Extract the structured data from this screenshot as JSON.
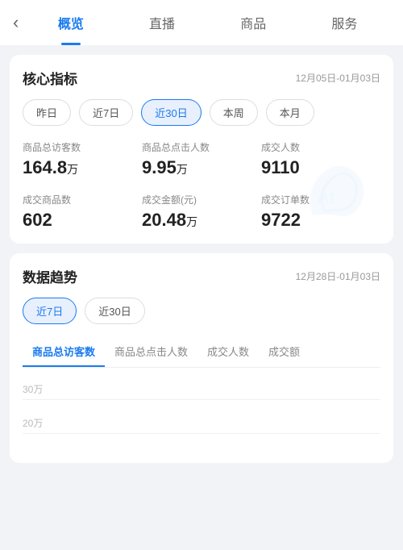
{
  "nav": {
    "back_icon": "‹",
    "tabs": [
      {
        "label": "概览",
        "active": true
      },
      {
        "label": "直播",
        "active": false
      },
      {
        "label": "商品",
        "active": false
      },
      {
        "label": "服务",
        "active": false
      }
    ]
  },
  "core_metrics": {
    "title": "核心指标",
    "date_range": "12月05日-01月03日",
    "filters": [
      {
        "label": "昨日",
        "active": false
      },
      {
        "label": "近7日",
        "active": false
      },
      {
        "label": "近30日",
        "active": true
      },
      {
        "label": "本周",
        "active": false
      },
      {
        "label": "本月",
        "active": false
      }
    ],
    "metrics": [
      {
        "label": "商品总访客数",
        "value": "164.8",
        "unit": "万"
      },
      {
        "label": "商品总点击人数",
        "value": "9.95",
        "unit": "万"
      },
      {
        "label": "成交人数",
        "value": "9110",
        "unit": ""
      },
      {
        "label": "成交商品数",
        "value": "602",
        "unit": ""
      },
      {
        "label": "成交金额(元)",
        "value": "20.48",
        "unit": "万"
      },
      {
        "label": "成交订单数",
        "value": "9722",
        "unit": ""
      }
    ]
  },
  "data_trend": {
    "title": "数据趋势",
    "date_range": "12月28日-01月03日",
    "filters": [
      {
        "label": "近7日",
        "active": true
      },
      {
        "label": "近30日",
        "active": false
      }
    ],
    "trend_tabs": [
      {
        "label": "商品总访客数",
        "active": true
      },
      {
        "label": "商品总点击人数",
        "active": false
      },
      {
        "label": "成交人数",
        "active": false
      },
      {
        "label": "成交额",
        "active": false
      }
    ],
    "chart_labels": [
      {
        "value": "30万"
      },
      {
        "value": "20万"
      }
    ]
  }
}
